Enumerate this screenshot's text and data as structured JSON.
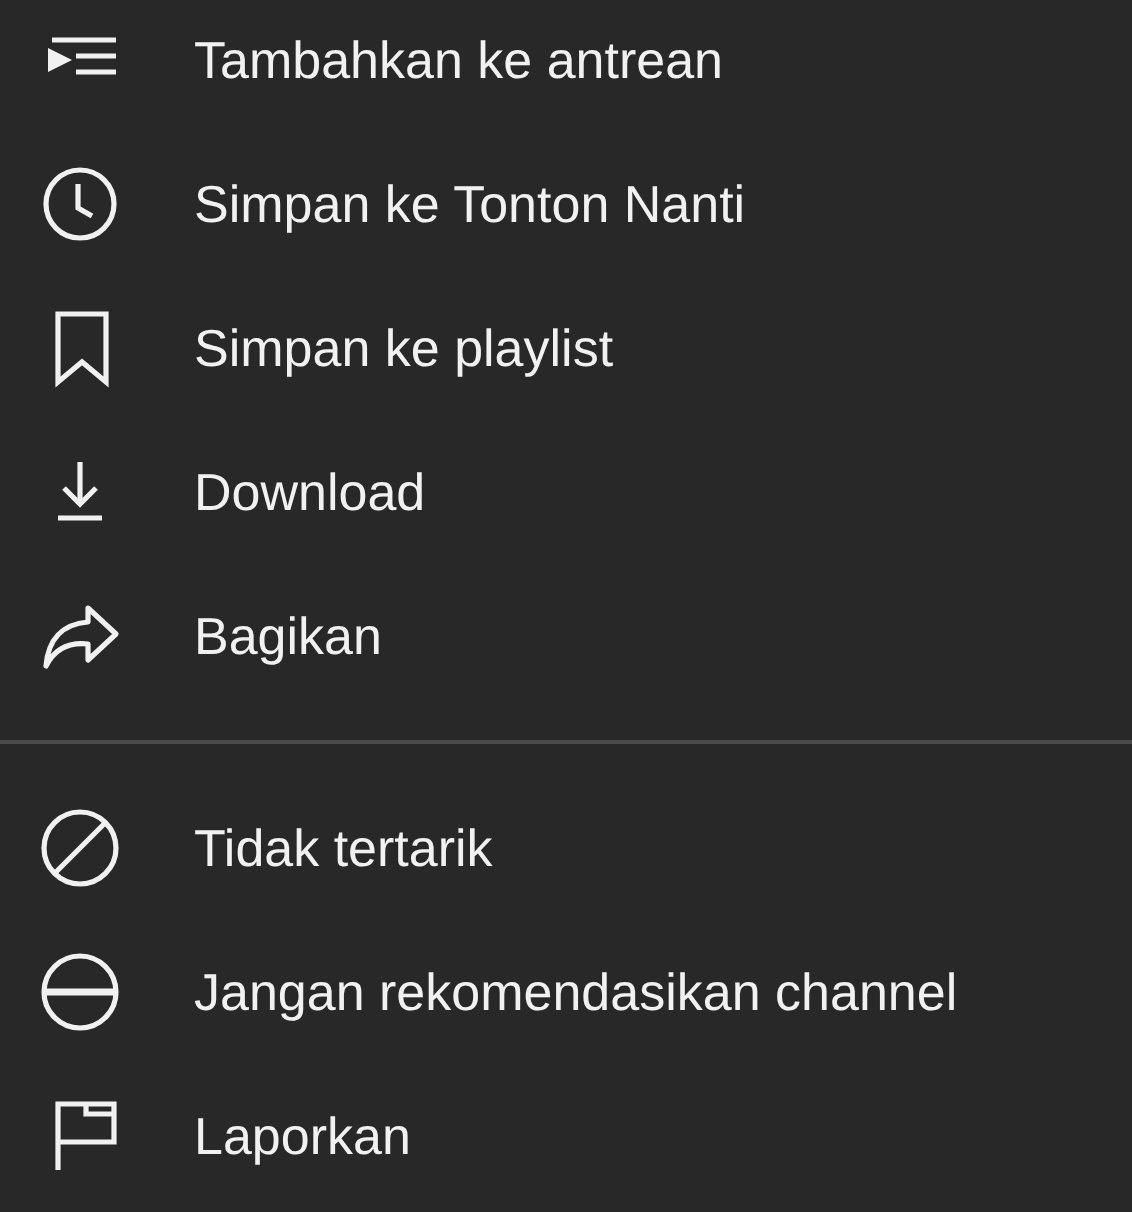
{
  "menu_sections": [
    {
      "items": [
        {
          "label": "Tambahkan ke antrean"
        },
        {
          "label": "Simpan ke Tonton Nanti"
        },
        {
          "label": "Simpan ke playlist"
        },
        {
          "label": "Download"
        },
        {
          "label": "Bagikan"
        }
      ]
    },
    {
      "items": [
        {
          "label": "Tidak tertarik"
        },
        {
          "label": "Jangan rekomendasikan channel"
        },
        {
          "label": "Laporkan"
        }
      ]
    }
  ]
}
